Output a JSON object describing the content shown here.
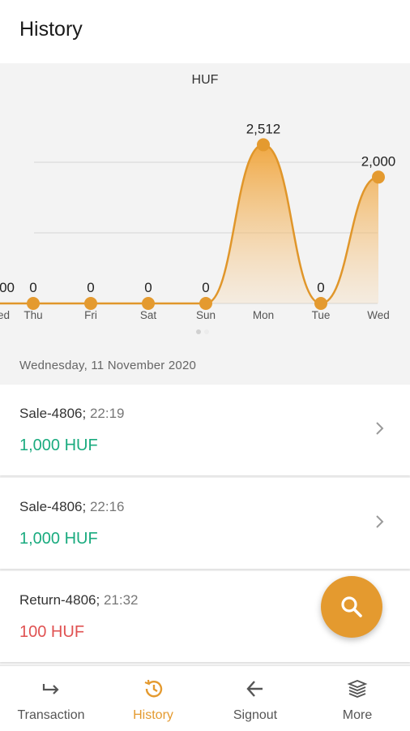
{
  "header": {
    "title": "History"
  },
  "colors": {
    "accent": "#e49a2f",
    "positive": "#1aab7f",
    "negative": "#e05252"
  },
  "chart_data": {
    "type": "area",
    "title": "HUF",
    "categories": [
      "Wed",
      "Thu",
      "Fri",
      "Sat",
      "Sun",
      "Mon",
      "Tue",
      "Wed"
    ],
    "values": [
      0,
      0,
      0,
      0,
      0,
      2512,
      0,
      2000
    ],
    "data_labels": [
      "0",
      "0",
      "0",
      "0",
      "0",
      "2,512",
      "0",
      "2,000"
    ],
    "partial_left_category": "ed",
    "partial_left_label": "00",
    "ylim": [
      0,
      2800
    ],
    "grid": true
  },
  "date_label": "Wednesday, 11 November 2020",
  "transactions": [
    {
      "ref": "Sale-4806;",
      "time": "22:19",
      "amount": "1,000 HUF",
      "kind": "positive"
    },
    {
      "ref": "Sale-4806;",
      "time": "22:16",
      "amount": "1,000 HUF",
      "kind": "positive"
    },
    {
      "ref": "Return-4806;",
      "time": "21:32",
      "amount": "100 HUF",
      "kind": "negative"
    }
  ],
  "fab": {
    "icon": "search-icon"
  },
  "bottom_nav": [
    {
      "label": "Transaction",
      "icon": "transaction-arrow-icon",
      "active": false
    },
    {
      "label": "History",
      "icon": "history-clock-icon",
      "active": true
    },
    {
      "label": "Signout",
      "icon": "arrow-left-icon",
      "active": false
    },
    {
      "label": "More",
      "icon": "layers-icon",
      "active": false
    }
  ]
}
